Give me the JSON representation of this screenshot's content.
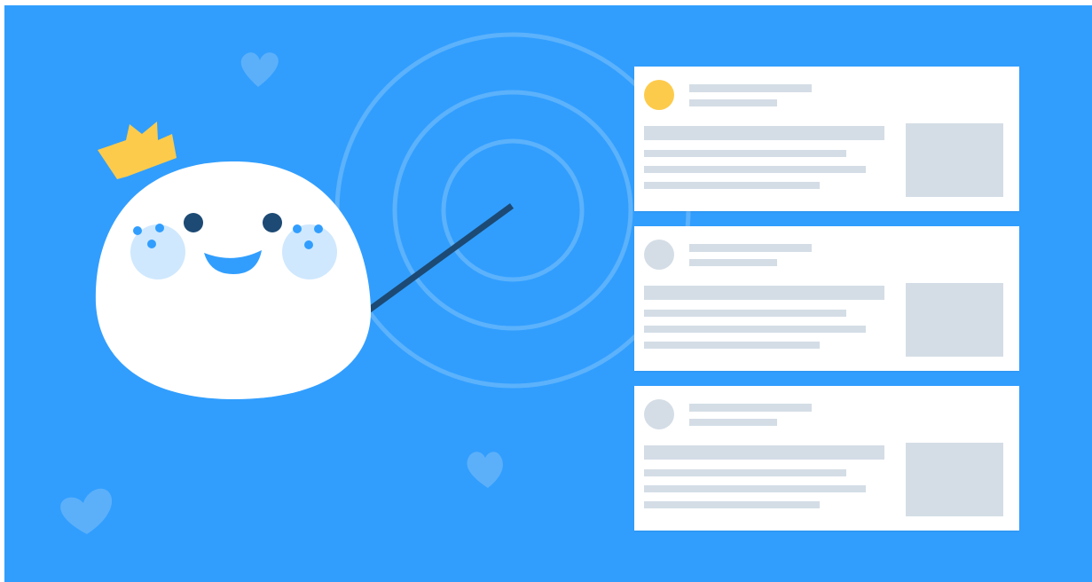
{
  "colors": {
    "background": "#319efe",
    "ring": "#5cb2fb",
    "heart": "#5cb0f9",
    "mascot": "#ffffff",
    "cheek": "#cfe8fe",
    "freckle": "#319efe",
    "eye": "#1c4a74",
    "mouth": "#319efe",
    "crown": "#fdcb4b",
    "pointer": "#1c4a74",
    "skeleton": "#d4dde6",
    "avatar_active": "#fdcb4b",
    "avatar_inactive": "#d4dde6",
    "card": "#ffffff"
  },
  "illustration": {
    "mascot": "blob-mascot-with-crown",
    "pointer": "pointer-stick",
    "target": "concentric-rings",
    "decorations": [
      "heart-icon",
      "heart-icon",
      "heart-icon"
    ]
  },
  "cards": [
    {
      "avatar_state": "highlighted"
    },
    {
      "avatar_state": "default"
    },
    {
      "avatar_state": "default"
    }
  ]
}
